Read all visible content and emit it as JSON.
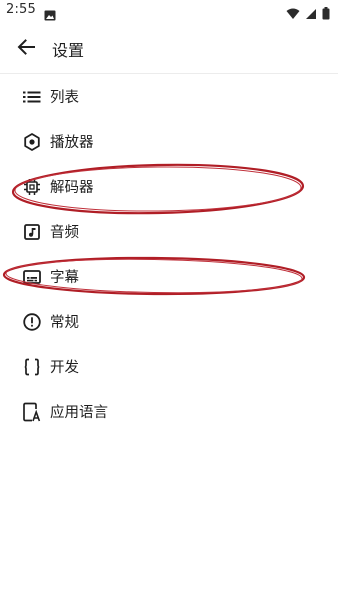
{
  "status_bar": {
    "time": "2:55"
  },
  "header": {
    "title": "设置"
  },
  "menu": {
    "items": [
      {
        "label": "列表",
        "icon": "list-icon"
      },
      {
        "label": "播放器",
        "icon": "hexagon-dot-icon"
      },
      {
        "label": "解码器",
        "icon": "chip-icon"
      },
      {
        "label": "音频",
        "icon": "music-note-icon"
      },
      {
        "label": "字幕",
        "icon": "subtitles-icon"
      },
      {
        "label": "常规",
        "icon": "alert-circle-icon"
      },
      {
        "label": "开发",
        "icon": "code-braces-icon"
      },
      {
        "label": "应用语言",
        "icon": "app-language-icon"
      }
    ]
  },
  "colors": {
    "annotation": "#b01e26",
    "text": "#1f1f1f"
  }
}
